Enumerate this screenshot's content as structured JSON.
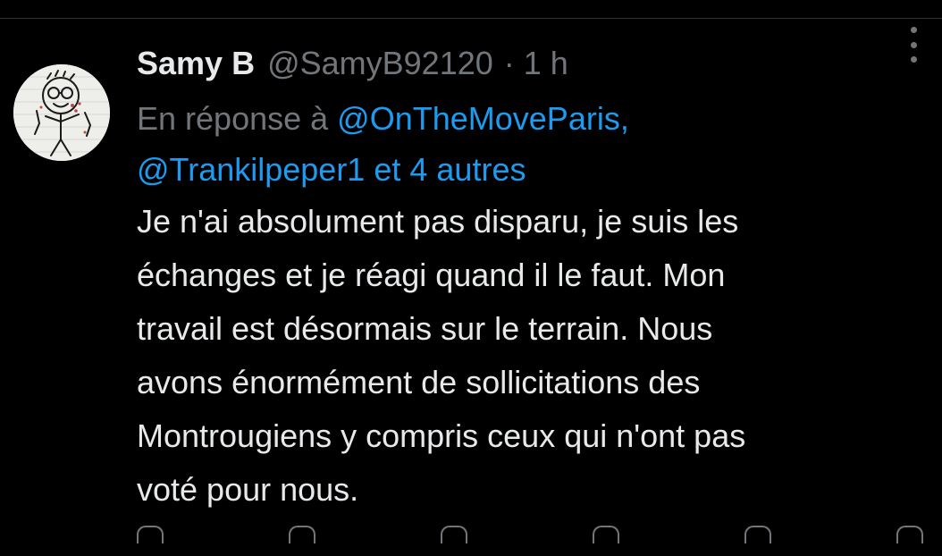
{
  "tweet": {
    "display_name": "Samy B",
    "handle": "@SamyB92120",
    "separator": "·",
    "time": "1 h",
    "reply_prefix": "En réponse à",
    "reply_mention_1": "@OnTheMoveParis,",
    "reply_mention_2": "@Trankilpeper1",
    "reply_and": "et",
    "reply_others": "4 autres",
    "body_lines": [
      "Je n'ai absolument pas disparu, je suis les",
      "échanges et je réagi quand il le faut. Mon",
      "travail est désormais sur le terrain. Nous",
      "avons énormément de sollicitations des",
      "Montrougiens y compris ceux qui n'ont pas",
      "voté pour nous."
    ]
  },
  "icons": {
    "avatar": "doodle-avatar",
    "more": "more-vertical-icon",
    "actions": [
      "reply-icon",
      "retweet-icon",
      "like-icon",
      "views-icon",
      "bookmark-icon",
      "share-icon"
    ]
  },
  "colors": {
    "background": "#000000",
    "text": "#e7e9ea",
    "muted": "#71767b",
    "link": "#1d9bf0",
    "divider": "#2f3336"
  }
}
